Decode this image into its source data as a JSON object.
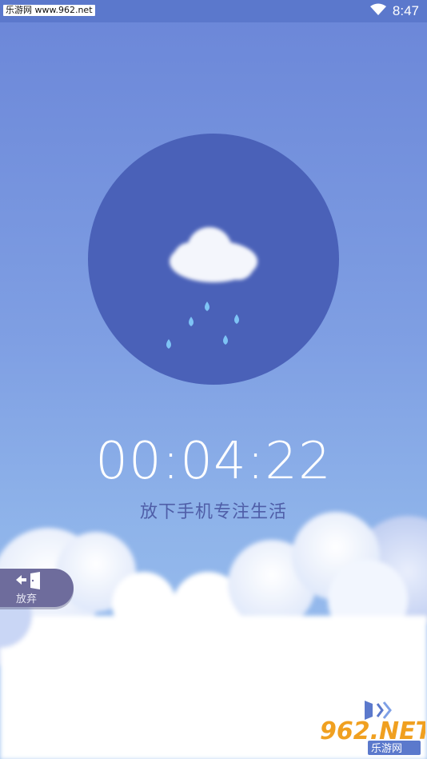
{
  "status_bar": {
    "watermark": "乐游网 www.962.net",
    "time": "8:47",
    "icons": [
      "wifi-icon"
    ]
  },
  "focus": {
    "timer": "00:04:22",
    "subtitle": "放下手机专注生活",
    "scene": "rain-cloud"
  },
  "actions": {
    "give_up_label": "放弃",
    "give_up_icon": "exit-door-icon"
  },
  "logo": {
    "brand": "962.NET",
    "brand_cn": "乐游网"
  },
  "colors": {
    "sky_top": "#6b86d8",
    "circle": "#4a61b8",
    "subtitle": "#4f5ea8",
    "give_up_button": "#6e6c9c",
    "raindrop": "#7ec3f5"
  }
}
